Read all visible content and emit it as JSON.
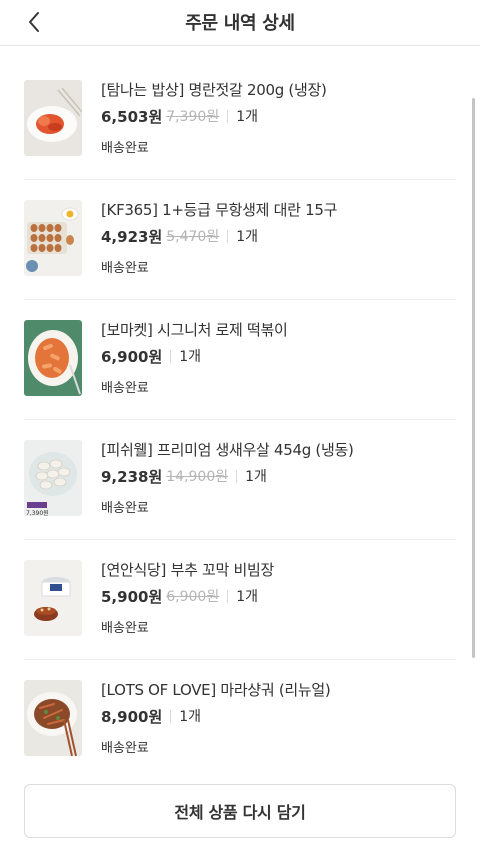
{
  "header": {
    "title": "주문 내역 상세",
    "back_icon": "chevron-left-icon"
  },
  "items": [
    {
      "name": "[탐나는 밥상] 명란젓갈 200g (냉장)",
      "price": "6,503원",
      "original_price": "7,390원",
      "quantity": "1개",
      "status": "배송완료"
    },
    {
      "name": "[KF365] 1+등급 무항생제 대란 15구",
      "price": "4,923원",
      "original_price": "5,470원",
      "quantity": "1개",
      "status": "배송완료"
    },
    {
      "name": "[보마켓] 시그니처 로제 떡볶이",
      "price": "6,900원",
      "original_price": "",
      "quantity": "1개",
      "status": "배송완료"
    },
    {
      "name": "[피쉬웰] 프리미엄 생새우살 454g (냉동)",
      "price": "9,238원",
      "original_price": "14,900원",
      "quantity": "1개",
      "status": "배송완료"
    },
    {
      "name": "[연안식당] 부추 꼬막 비빔장",
      "price": "5,900원",
      "original_price": "6,900원",
      "quantity": "1개",
      "status": "배송완료"
    },
    {
      "name": "[LOTS OF LOVE] 마라샹궈 (리뉴얼)",
      "price": "8,900원",
      "original_price": "",
      "quantity": "1개",
      "status": "배송완료"
    }
  ],
  "thumb_badges": {
    "shrimp": "7,390원"
  },
  "footer": {
    "reorder_label": "전체 상품 다시 담기"
  }
}
